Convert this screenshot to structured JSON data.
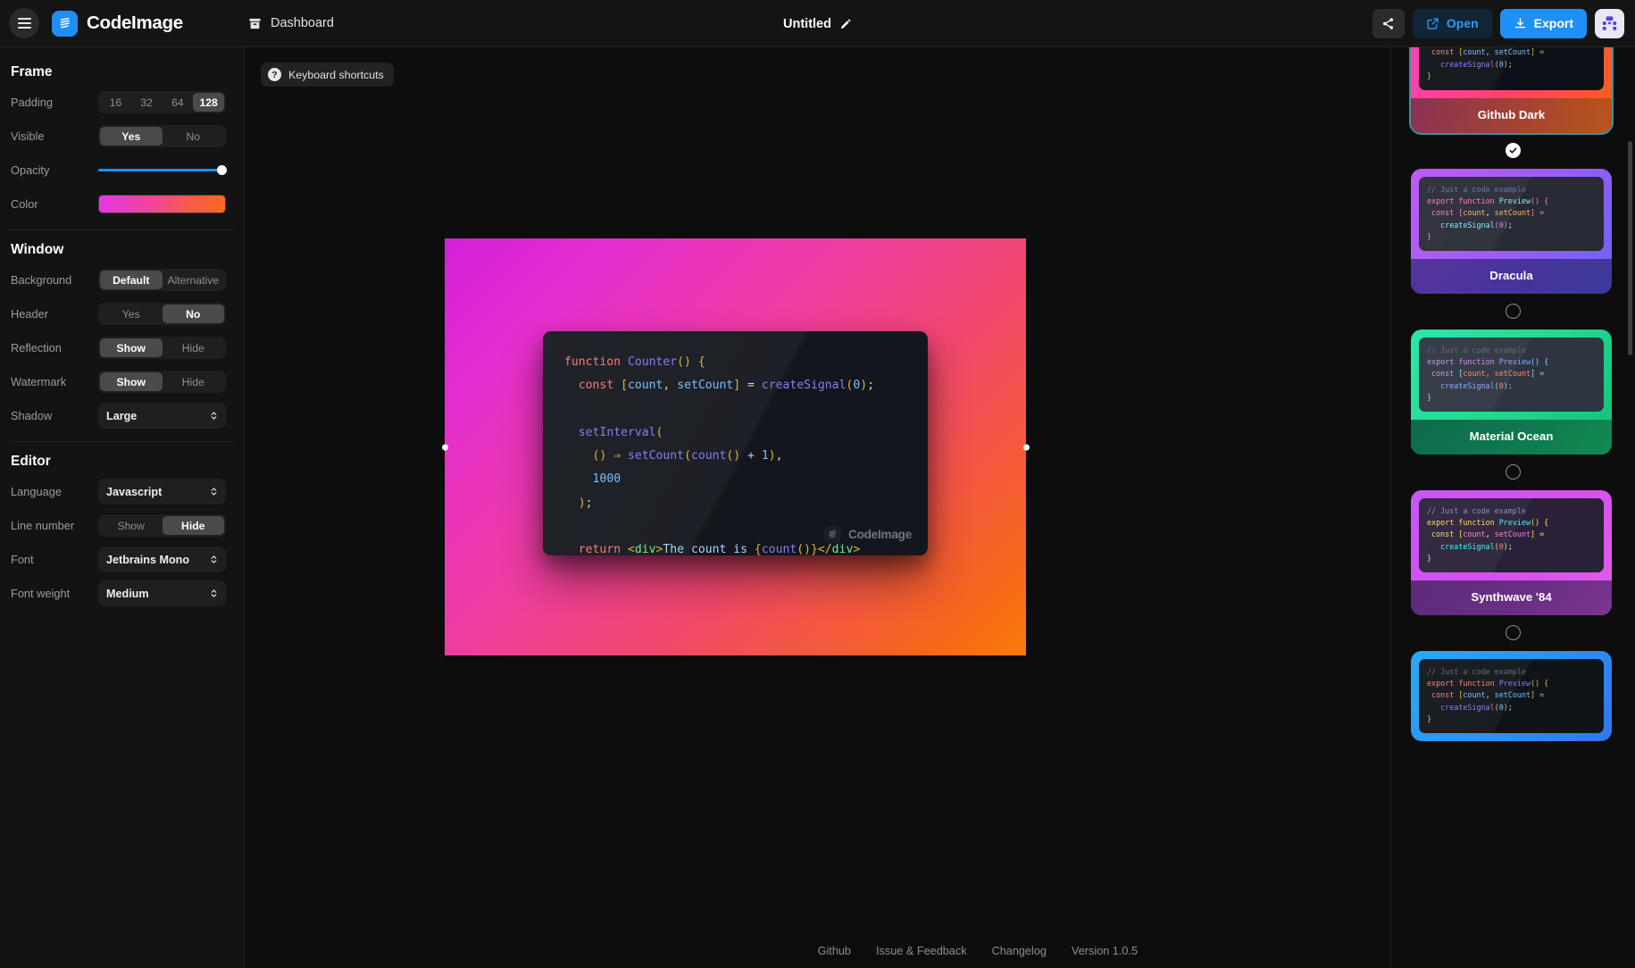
{
  "app": {
    "brand_name": "CodeImage",
    "menu_icon": "hamburger-icon",
    "logo_icon": "codeimage-logo-icon"
  },
  "topbar": {
    "dashboard_label": "Dashboard",
    "dashboard_icon": "archive-icon",
    "project_title": "Untitled",
    "edit_icon": "pencil-icon",
    "share_icon": "share-icon",
    "open_label": "Open",
    "open_icon": "external-link-icon",
    "export_label": "Export",
    "export_icon": "download-icon",
    "avatar_icon": "user-avatar-icon",
    "accent_blue": "#1e90f5",
    "open_text_color": "#2f9bf5"
  },
  "canvas": {
    "keyboard_shortcuts_label": "Keyboard shortcuts",
    "help_icon": "question-mark-icon",
    "watermark_label": "CodeImage",
    "watermark_icon": "codeimage-logo-icon"
  },
  "sidebar": {
    "sections": [
      {
        "title": "Frame",
        "rows": [
          {
            "label": "Padding",
            "type": "segmented",
            "options": [
              "16",
              "32",
              "64",
              "128"
            ],
            "selected": "128"
          },
          {
            "label": "Visible",
            "type": "segmented",
            "options": [
              "Yes",
              "No"
            ],
            "selected": "Yes"
          },
          {
            "label": "Opacity",
            "type": "slider",
            "value": "100"
          },
          {
            "label": "Color",
            "type": "color",
            "value": "#e736e7 → #fc6a1f"
          }
        ]
      },
      {
        "title": "Window",
        "rows": [
          {
            "label": "Background",
            "type": "segmented",
            "options": [
              "Default",
              "Alternative"
            ],
            "selected": "Default"
          },
          {
            "label": "Header",
            "type": "segmented",
            "options": [
              "Yes",
              "No"
            ],
            "selected": "No"
          },
          {
            "label": "Reflection",
            "type": "segmented",
            "options": [
              "Show",
              "Hide"
            ],
            "selected": "Show"
          },
          {
            "label": "Watermark",
            "type": "segmented",
            "options": [
              "Show",
              "Hide"
            ],
            "selected": "Show"
          },
          {
            "label": "Shadow",
            "type": "select",
            "value": "Large"
          }
        ]
      },
      {
        "title": "Editor",
        "rows": [
          {
            "label": "Language",
            "type": "select",
            "value": "Javascript"
          },
          {
            "label": "Line number",
            "type": "segmented",
            "options": [
              "Show",
              "Hide"
            ],
            "selected": "Hide"
          },
          {
            "label": "Font",
            "type": "select",
            "value": "Jetbrains Mono"
          },
          {
            "label": "Font weight",
            "type": "select",
            "value": "Medium"
          }
        ]
      }
    ]
  },
  "editor_code": {
    "lines": [
      [
        {
          "t": "function",
          "c": "kw"
        },
        {
          "t": " ",
          "c": "plain"
        },
        {
          "t": "Counter",
          "c": "fn"
        },
        {
          "t": "()",
          "c": "pun"
        },
        {
          "t": " ",
          "c": "plain"
        },
        {
          "t": "{",
          "c": "pun"
        }
      ],
      [
        {
          "t": "  ",
          "c": "plain"
        },
        {
          "t": "const",
          "c": "kw"
        },
        {
          "t": " ",
          "c": "plain"
        },
        {
          "t": "[",
          "c": "pun"
        },
        {
          "t": "count",
          "c": "var"
        },
        {
          "t": ",",
          "c": "plain"
        },
        {
          "t": " ",
          "c": "plain"
        },
        {
          "t": "setCount",
          "c": "var"
        },
        {
          "t": "]",
          "c": "pun"
        },
        {
          "t": " = ",
          "c": "plain"
        },
        {
          "t": "createSignal",
          "c": "fn"
        },
        {
          "t": "(",
          "c": "pun"
        },
        {
          "t": "0",
          "c": "num"
        },
        {
          "t": ")",
          "c": "pun"
        },
        {
          "t": ";",
          "c": "plain"
        }
      ],
      [],
      [
        {
          "t": "  ",
          "c": "plain"
        },
        {
          "t": "setInterval",
          "c": "fn"
        },
        {
          "t": "(",
          "c": "pun"
        }
      ],
      [
        {
          "t": "    ",
          "c": "plain"
        },
        {
          "t": "()",
          "c": "pun"
        },
        {
          "t": " ",
          "c": "plain"
        },
        {
          "t": "⇒",
          "c": "pun"
        },
        {
          "t": " ",
          "c": "plain"
        },
        {
          "t": "setCount",
          "c": "fn"
        },
        {
          "t": "(",
          "c": "pun"
        },
        {
          "t": "count",
          "c": "fn"
        },
        {
          "t": "()",
          "c": "pun"
        },
        {
          "t": " + ",
          "c": "plain"
        },
        {
          "t": "1",
          "c": "num"
        },
        {
          "t": ")",
          "c": "pun"
        },
        {
          "t": ",",
          "c": "plain"
        }
      ],
      [
        {
          "t": "    ",
          "c": "plain"
        },
        {
          "t": "1000",
          "c": "num"
        }
      ],
      [
        {
          "t": "  ",
          "c": "plain"
        },
        {
          "t": ")",
          "c": "pun"
        },
        {
          "t": ";",
          "c": "plain"
        }
      ],
      [],
      [
        {
          "t": "  ",
          "c": "plain"
        },
        {
          "t": "return",
          "c": "kw"
        },
        {
          "t": " ",
          "c": "plain"
        },
        {
          "t": "<",
          "c": "pun"
        },
        {
          "t": "div",
          "c": "tag"
        },
        {
          "t": ">",
          "c": "pun"
        },
        {
          "t": "The count is ",
          "c": "str"
        },
        {
          "t": "{",
          "c": "pun"
        },
        {
          "t": "count",
          "c": "fn"
        },
        {
          "t": "()",
          "c": "pun"
        },
        {
          "t": "}",
          "c": "pun"
        },
        {
          "t": "<",
          "c": "pun"
        },
        {
          "t": "/",
          "c": "pun"
        },
        {
          "t": "div",
          "c": "tag"
        },
        {
          "t": ">",
          "c": "pun"
        }
      ],
      [
        {
          "t": "}",
          "c": "pun"
        }
      ]
    ],
    "plain_text": "function Counter() {\n  const [count, setCount] = createSignal(0);\n\n  setInterval(\n    () ⇒ setCount(count() + 1),\n    1000\n  );\n\n  return <div>The count is {count()}</div>\n}"
  },
  "themes": {
    "preview_code": "// Just a code example\nexport function Preview() {\n const [count, setCount] =\n   createSignal(0);\n}",
    "items": [
      {
        "name": "Github Dark",
        "selected": true,
        "gradient": "linear-gradient(100deg, #ff40b4 0%, #f5456b 48%, #fb5d1c 100%)",
        "footer": "linear-gradient(100deg, #8b3153 0%, #a7452f 60%, #b8551b 100%)",
        "code_bg": "#0d1117",
        "colors": {
          "comment": "#8b949e",
          "keyword": "#ff7b72",
          "function": "#8a7cf8",
          "punct": "#e3b341",
          "var": "#79c0ff",
          "plain": "#c9d1d9",
          "num": "#79c0ff"
        }
      },
      {
        "name": "Dracula",
        "selected": false,
        "gradient": "linear-gradient(125deg, #c05bf5 0%, #a25cf7 45%, #6c63f5 100%)",
        "footer": "linear-gradient(125deg, #54359c 0%, #46349b 60%, #3b3a99 100%)",
        "code_bg": "#282a36",
        "colors": {
          "comment": "#6272a4",
          "keyword": "#ff79c6",
          "function": "#8be9fd",
          "punct": "#ff79c6",
          "var": "#ffb86c",
          "plain": "#f8f8f2",
          "num": "#bd93f9"
        }
      },
      {
        "name": "Material Ocean",
        "selected": false,
        "gradient": "linear-gradient(130deg, #2ee6a8 0%, #22d98f 50%, #12c07a 100%)",
        "footer": "linear-gradient(130deg, #0d6b4c 0%, #0f7a50 60%, #118b52 100%)",
        "code_bg": "#2e3440",
        "colors": {
          "comment": "#5c6370",
          "keyword": "#c792ea",
          "function": "#82aaff",
          "punct": "#89ddff",
          "var": "#f78c6c",
          "plain": "#a6accd",
          "num": "#f78c6c"
        }
      },
      {
        "name": "Synthwave '84",
        "selected": false,
        "gradient": "linear-gradient(130deg, #c658f5 0%, #d84ef0 50%, #e05ce8 100%)",
        "footer": "linear-gradient(130deg, #5c2b7a 0%, #6b2f85 60%, #7a3490 100%)",
        "code_bg": "#2a2139",
        "colors": {
          "comment": "#848bbd",
          "keyword": "#fede5d",
          "function": "#36f9f6",
          "punct": "#fede5d",
          "var": "#ff7edb",
          "plain": "#f8f8f2",
          "num": "#f97e72"
        }
      },
      {
        "name": "",
        "selected": false,
        "gradient": "linear-gradient(130deg, #2aa8f5 0%, #2e8ef0 60%, #3376ea 100%)",
        "footer": "linear-gradient(130deg, #1a4c75 0%, #1d4580 100%)",
        "code_bg": "#0f1419",
        "colors": {
          "comment": "#5c6773",
          "keyword": "#ff7b72",
          "function": "#8a7cf8",
          "punct": "#e3b341",
          "var": "#79c0ff",
          "plain": "#c9d1d9",
          "num": "#79c0ff"
        }
      }
    ]
  },
  "footer": {
    "links": [
      "Github",
      "Issue & Feedback",
      "Changelog"
    ],
    "version": "Version 1.0.5"
  }
}
